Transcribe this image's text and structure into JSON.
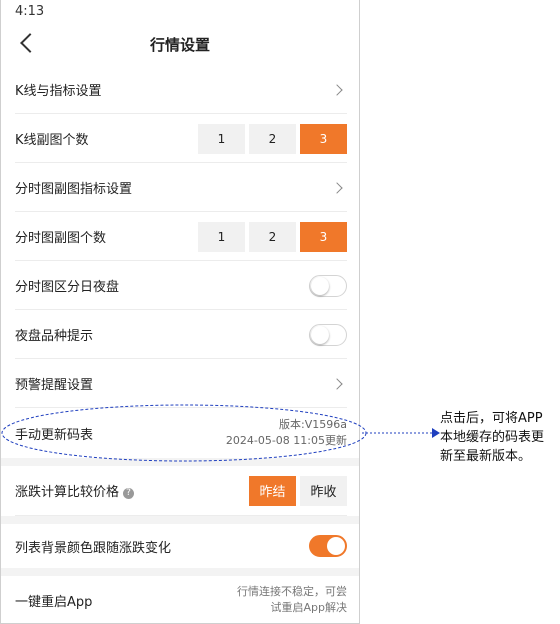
{
  "status_bar": {
    "time": "4:13"
  },
  "nav": {
    "title": "行情设置"
  },
  "rows": {
    "kline_settings": "K线与指标设置",
    "kline_sub_count": {
      "label": "K线副图个数",
      "options": [
        "1",
        "2",
        "3"
      ],
      "selected": "3"
    },
    "timeshare_indicator": "分时图副图指标设置",
    "timeshare_sub_count": {
      "label": "分时图副图个数",
      "options": [
        "1",
        "2",
        "3"
      ],
      "selected": "3"
    },
    "timeshare_split_night": {
      "label": "分时图区分日夜盘",
      "on": false
    },
    "night_product_tip": {
      "label": "夜盘品种提示",
      "on": false
    },
    "alert_settings": "预警提醒设置",
    "manual_update": {
      "label": "手动更新码表",
      "version": "版本:V1596a",
      "updated": "2024-05-08 11:05更新"
    },
    "price_compare": {
      "label": "涨跌计算比较价格",
      "help": "?",
      "options": [
        "昨结",
        "昨收"
      ],
      "selected": "昨结"
    },
    "list_bg_color": {
      "label": "列表背景颜色跟随涨跌变化",
      "on": true
    },
    "restart_app": {
      "label": "一键重启App",
      "note_line1": "行情连接不稳定，可尝",
      "note_line2": "试重启App解决"
    }
  },
  "annotation": {
    "line1": "点击后，可将APP",
    "line2": "本地缓存的码表更",
    "line3": "新至最新版本。"
  },
  "colors": {
    "accent": "#f0782a",
    "annotation_blue": "#1f3fbf"
  }
}
